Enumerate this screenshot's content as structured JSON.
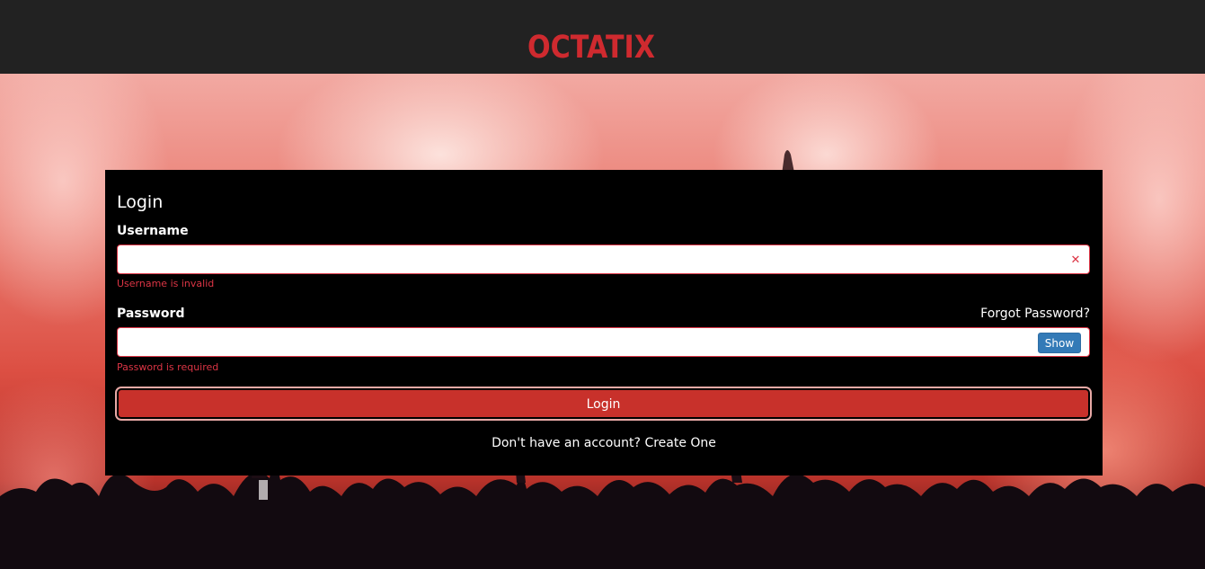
{
  "header": {
    "logo_text": "OCTATIX",
    "logo_color": "#cf2a2f"
  },
  "login": {
    "title": "Login",
    "username": {
      "label": "Username",
      "value": "",
      "error": "Username is invalid",
      "clear_icon": "close-icon"
    },
    "password": {
      "label": "Password",
      "value": "",
      "error": "Password is required",
      "forgot_link": "Forgot Password?",
      "show_button": "Show"
    },
    "submit_label": "Login",
    "signup_prompt": "Don't have an account?",
    "signup_link": "Create One"
  },
  "colors": {
    "accent": "#c8312b",
    "error": "#dc3545",
    "show_button": "#337ab7",
    "header_bg": "#222222"
  }
}
